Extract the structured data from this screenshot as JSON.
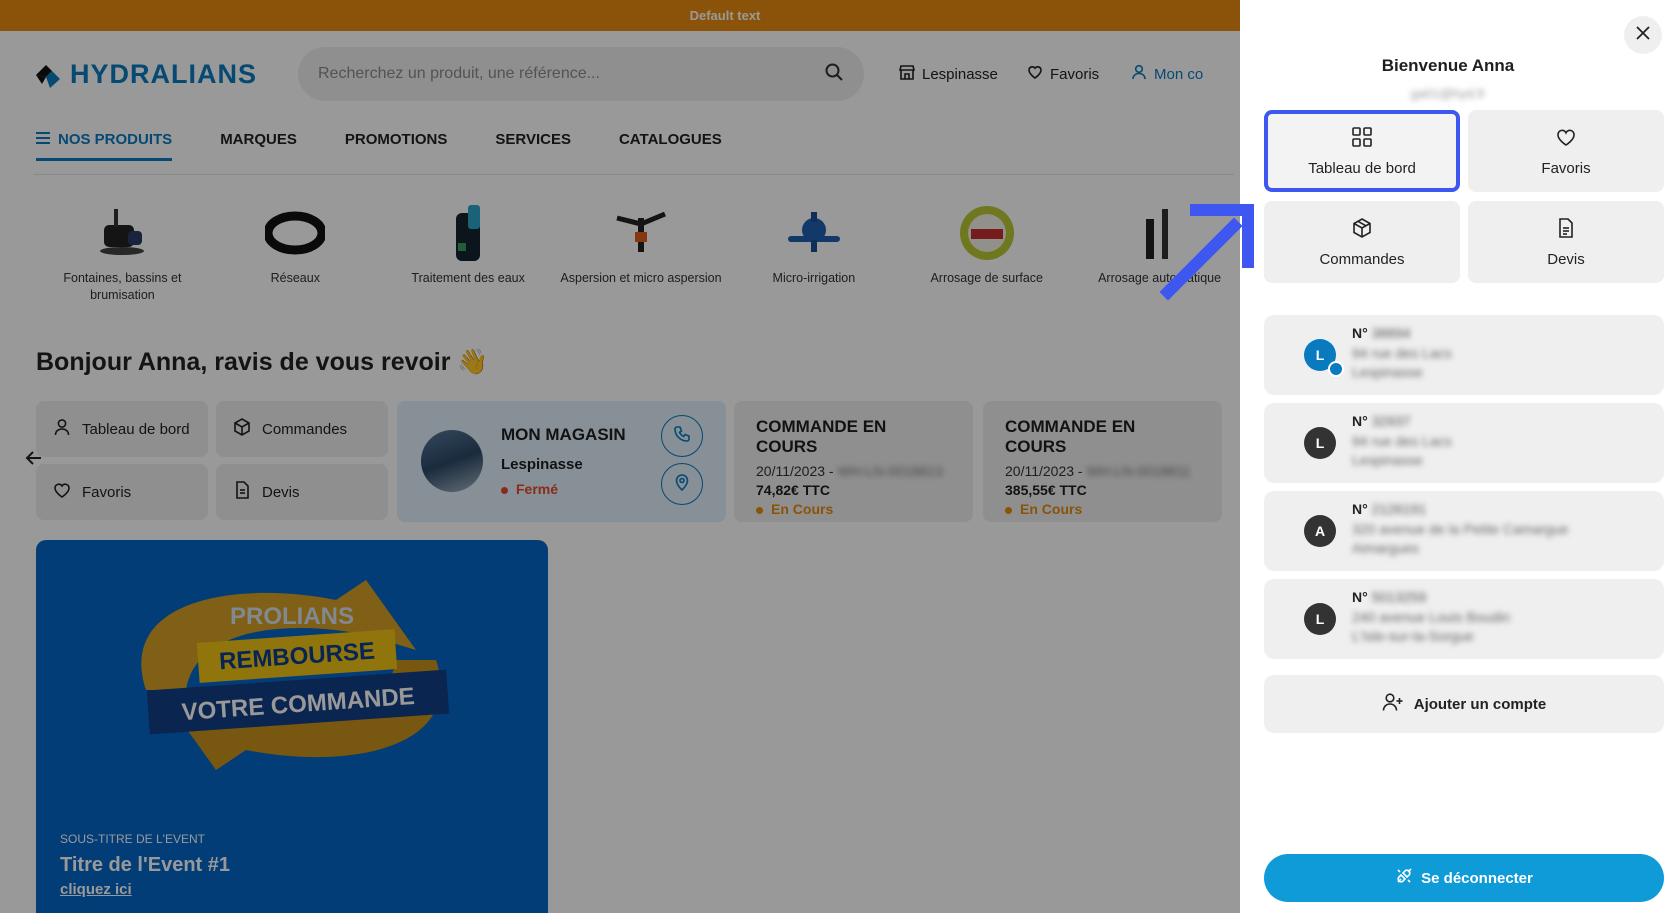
{
  "topbar": {
    "text": "Default text"
  },
  "header": {
    "logo": "HYDRALIANS",
    "search_placeholder": "Recherchez un produit, une référence...",
    "store": "Lespinasse",
    "favorites": "Favoris",
    "account": "Mon co"
  },
  "nav": {
    "products": "NOS PRODUITS",
    "brands": "MARQUES",
    "promotions": "PROMOTIONS",
    "services": "SERVICES",
    "catalogs": "CATALOGUES"
  },
  "categories": [
    "Fontaines, bassins et brumisation",
    "Réseaux",
    "Traitement des eaux",
    "Aspersion et micro aspersion",
    "Micro-irrigation",
    "Arrosage de surface",
    "Arrosage automatique"
  ],
  "greeting": "Bonjour Anna, ravis de vous revoir 👋",
  "quick": {
    "dashboard": "Tableau de bord",
    "orders": "Commandes",
    "favorites": "Favoris",
    "quotes": "Devis"
  },
  "store": {
    "title": "MON MAGASIN",
    "city": "Lespinasse",
    "status": "Fermé"
  },
  "orders": [
    {
      "title": "COMMANDE EN COURS",
      "date": "20/11/2023 - ",
      "price": "74,82€ TTC",
      "status": "En Cours"
    },
    {
      "title": "COMMANDE EN COURS",
      "date": "20/11/2023 - ",
      "price": "385,55€ TTC",
      "status": "En Cours"
    }
  ],
  "event": {
    "banner": {
      "line1": "PROLIANS",
      "line2": "REMBOURSE",
      "line3": "VOTRE COMMANDE"
    },
    "subtitle": "SOUS-TITRE DE L'EVENT",
    "title": "Titre de l'Event #1",
    "link": "cliquez ici"
  },
  "drawer": {
    "title": "Bienvenue Anna",
    "tiles": {
      "dashboard": "Tableau de bord",
      "favorites": "Favoris",
      "orders": "Commandes",
      "quotes": "Devis"
    },
    "accounts": [
      {
        "initial": "L",
        "label": "N°"
      },
      {
        "initial": "L",
        "label": "N°"
      },
      {
        "initial": "A",
        "label": "N°"
      },
      {
        "initial": "L",
        "label": "N°"
      }
    ],
    "add_account": "Ajouter un compte",
    "logout": "Se déconnecter"
  },
  "colors": {
    "brand_blue": "#0a7abf",
    "topbar_orange": "#e88a0f",
    "highlight": "#3d57f0",
    "status_orange": "#e58a0f",
    "closed_red": "#e5492a"
  }
}
